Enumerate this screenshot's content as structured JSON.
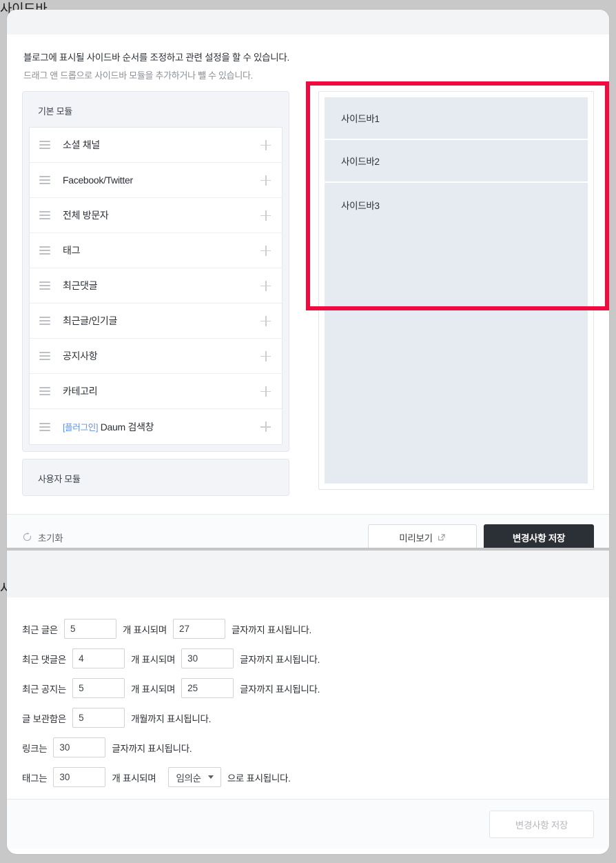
{
  "sidebar_section": {
    "title": "사이드바",
    "intro_line1": "블로그에 표시될 사이드바 순서를 조정하고 관련 설정을 할 수 있습니다.",
    "intro_line2": "드래그 앤 드롭으로 사이드바 모듈을 추가하거나 뺄 수 있습니다.",
    "palette": {
      "basic_group_label": "기본 모듈",
      "user_group_label": "사용자 모듈",
      "modules": [
        {
          "label": "소셜 채널",
          "plugin_tag": ""
        },
        {
          "label": "Facebook/Twitter",
          "plugin_tag": ""
        },
        {
          "label": "전체 방문자",
          "plugin_tag": ""
        },
        {
          "label": "태그",
          "plugin_tag": ""
        },
        {
          "label": "최근댓글",
          "plugin_tag": ""
        },
        {
          "label": "최근글/인기글",
          "plugin_tag": ""
        },
        {
          "label": "공지사항",
          "plugin_tag": ""
        },
        {
          "label": "카테고리",
          "plugin_tag": ""
        },
        {
          "label": "Daum 검색창",
          "plugin_tag": "[플러그인]"
        }
      ],
      "add_icon": "plus-icon",
      "drag_icon": "drag-handle-icon"
    },
    "dropzone": {
      "slots": [
        "사이드바1",
        "사이드바2",
        "사이드바3"
      ]
    },
    "footer": {
      "reset_label": "초기화",
      "reset_icon": "refresh-icon",
      "preview_label": "미리보기",
      "preview_icon": "external-link-icon",
      "save_label": "변경사항 저장"
    },
    "highlight_color": "#ef0b3f"
  },
  "settings_section": {
    "title": "사이드바 설정",
    "rows": [
      {
        "id": "recent-posts",
        "prefix": "최근 글은",
        "count": "5",
        "middle": "개 표시되며",
        "length": "27",
        "suffix": "글자까지 표시됩니다."
      },
      {
        "id": "recent-comments",
        "prefix": "최근 댓글은",
        "count": "4",
        "middle": "개 표시되며",
        "length": "30",
        "suffix": "글자까지 표시됩니다."
      },
      {
        "id": "recent-notices",
        "prefix": "최근 공지는",
        "count": "5",
        "middle": "개 표시되며",
        "length": "25",
        "suffix": "글자까지 표시됩니다."
      },
      {
        "id": "archive",
        "prefix": "글 보관함은",
        "count": "5",
        "middle": "",
        "length": "",
        "suffix": "개월까지 표시됩니다."
      },
      {
        "id": "links",
        "prefix": "링크는",
        "count": "30",
        "middle": "",
        "length": "",
        "suffix": "글자까지 표시됩니다."
      },
      {
        "id": "tags",
        "prefix": "태그는",
        "count": "30",
        "middle": "개 표시되며",
        "sort": "임의순",
        "suffix": "으로 표시됩니다."
      }
    ],
    "tag_sort_value": "임의순",
    "save_label": "변경사항 저장"
  }
}
